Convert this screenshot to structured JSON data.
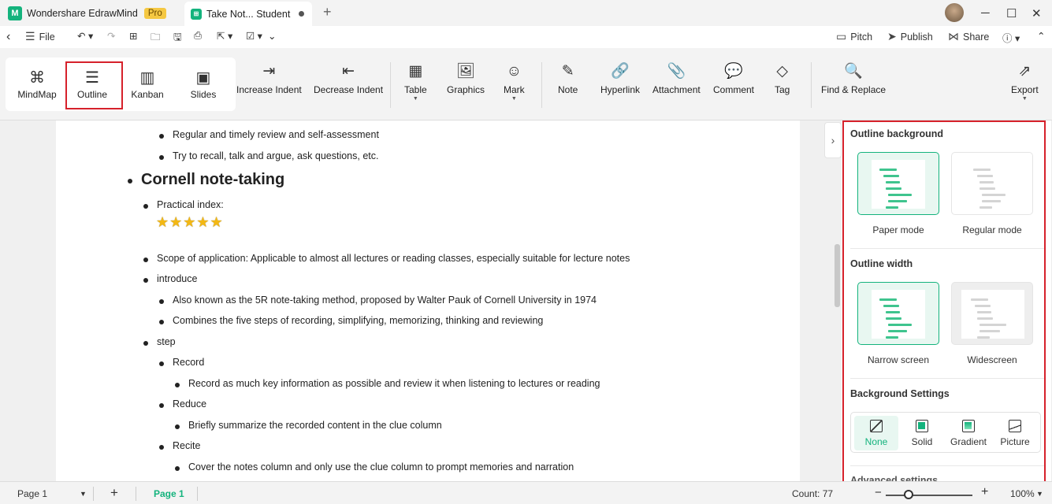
{
  "titlebar": {
    "app_name": "Wondershare EdrawMind",
    "badge": "Pro",
    "doc_tab": "Take Not... Student",
    "app_logo": "M",
    "doc_logo": "⊞"
  },
  "menubar": {
    "file": "File",
    "pitch": "Pitch",
    "publish": "Publish",
    "share": "Share"
  },
  "ribbon": {
    "views": [
      {
        "label": "MindMap",
        "icon": "mindmap-icon"
      },
      {
        "label": "Outline",
        "icon": "outline-icon"
      },
      {
        "label": "Kanban",
        "icon": "kanban-icon"
      },
      {
        "label": "Slides",
        "icon": "slides-icon"
      }
    ],
    "tools": {
      "increase_indent": "Increase Indent",
      "decrease_indent": "Decrease Indent",
      "table": "Table",
      "graphics": "Graphics",
      "mark": "Mark",
      "note": "Note",
      "hyperlink": "Hyperlink",
      "attachment": "Attachment",
      "comment": "Comment",
      "tag": "Tag",
      "find_replace": "Find & Replace",
      "export": "Export"
    }
  },
  "outline": {
    "line1": "Regular and timely review and self-assessment",
    "line2": "Try to recall, talk and argue, ask questions, etc.",
    "heading": "Cornell note-taking",
    "practical": "Practical index:",
    "stars": "★★★★★",
    "scope": "Scope of application: Applicable to almost all lectures or reading classes, especially suitable for lecture notes",
    "introduce": "introduce",
    "intro1": "Also known as the 5R note-taking method, proposed by Walter Pauk of Cornell University in 1974",
    "intro2": "Combines the five steps of recording, simplifying, memorizing, thinking and reviewing",
    "step": "step",
    "record": "Record",
    "record_desc": "Record as much key information as possible and review it when listening to lectures or reading",
    "reduce": "Reduce",
    "reduce_desc": "Briefly summarize the recorded content in the clue column",
    "recite": "Recite",
    "recite_desc": "Cover the notes column and only use the clue column to prompt memories and narration"
  },
  "panel": {
    "bg_title": "Outline background",
    "paper_mode": "Paper mode",
    "regular_mode": "Regular mode",
    "width_title": "Outline width",
    "narrow": "Narrow screen",
    "wide": "Widescreen",
    "bgset_title": "Background Settings",
    "bg_options": [
      "None",
      "Solid",
      "Gradient",
      "Picture"
    ],
    "advanced": "Advanced settings",
    "accent": "#14b37d"
  },
  "status": {
    "page_select": "Page 1",
    "page_tab": "Page 1",
    "count": "Count: 77",
    "zoom": "100%"
  }
}
